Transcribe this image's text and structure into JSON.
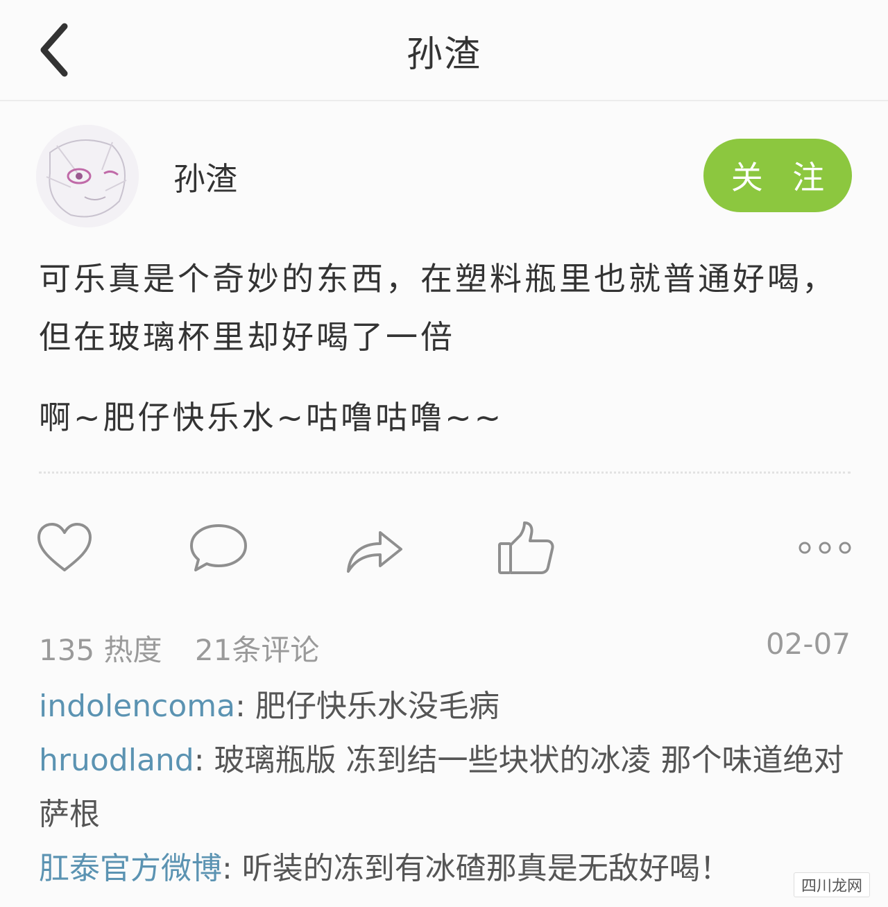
{
  "header": {
    "title": "孙渣",
    "back_icon": "chevron-left-icon"
  },
  "author": {
    "name": "孙渣",
    "follow_label": "关 注",
    "follow_color": "#8cc73f"
  },
  "post": {
    "paragraph1": "可乐真是个奇妙的东西，在塑料瓶里也就普通好喝，但在玻璃杯里却好喝了一倍",
    "paragraph2": "啊~肥仔快乐水~咕噜咕噜~~"
  },
  "actions": [
    "heart-icon",
    "comment-icon",
    "share-icon",
    "thumbs-up-icon",
    "more-icon"
  ],
  "stats": {
    "heat": "135 热度",
    "comments": "21条评论",
    "date": "02-07"
  },
  "comments": [
    {
      "user": "indolencoma",
      "text": ": 肥仔快乐水没毛病"
    },
    {
      "user": "hruodland",
      "text": ": 玻璃瓶版 冻到结一些块状的冰凌 那个味道绝对萨根"
    },
    {
      "user": "肛泰官方微博",
      "text": ": 听装的冻到有冰碴那真是无敌好喝！"
    }
  ],
  "watermark": "四川龙网",
  "colors": {
    "accent": "#8cc73f",
    "link": "#5b93b2",
    "muted": "#9a9a9a"
  }
}
